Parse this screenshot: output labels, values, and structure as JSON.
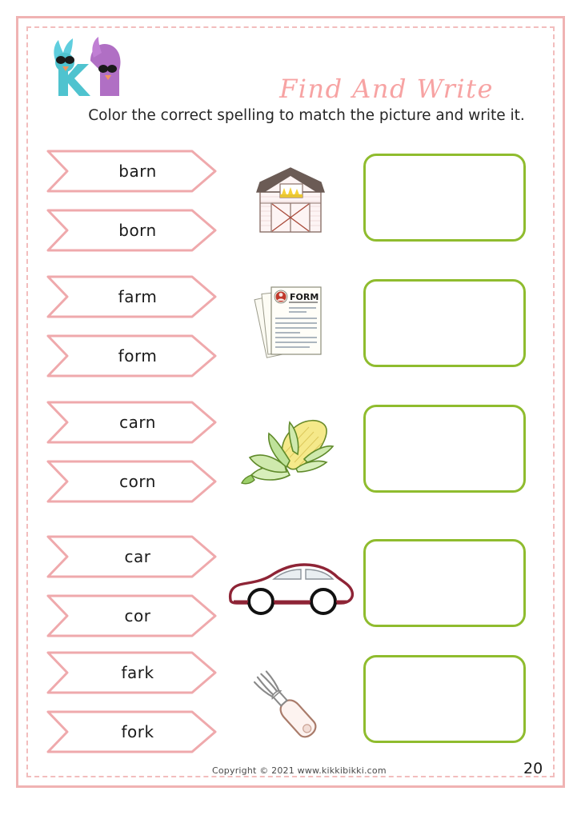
{
  "header": {
    "logo_alt": "kikkibikki-logo",
    "title": "Find And Write",
    "subtitle": "Color the correct spelling to match the picture and write it."
  },
  "colors": {
    "frame_pink": "#f0b3b3",
    "dash_pink": "#f2bdbd",
    "banner_outline": "#efa9ac",
    "title_pink": "#f7a3a3",
    "answer_green": "#8fbc2e",
    "text_dark": "#1a1a1a"
  },
  "rows": [
    {
      "options": [
        "barn",
        "born"
      ],
      "picture": "barn-image",
      "answer_value": "",
      "answer_placeholder": ""
    },
    {
      "options": [
        "farm",
        "form"
      ],
      "picture": "form-document-image",
      "answer_value": "",
      "answer_placeholder": ""
    },
    {
      "options": [
        "carn",
        "corn"
      ],
      "picture": "corn-image",
      "answer_value": "",
      "answer_placeholder": ""
    },
    {
      "options": [
        "car",
        "cor"
      ],
      "picture": "car-image",
      "answer_value": "",
      "answer_placeholder": ""
    },
    {
      "options": [
        "fark",
        "fork"
      ],
      "picture": "fork-image",
      "answer_value": "",
      "answer_placeholder": ""
    }
  ],
  "footer": {
    "copyright": "Copyright © 2021 www.kikkibikki.com",
    "page_number": "20"
  }
}
